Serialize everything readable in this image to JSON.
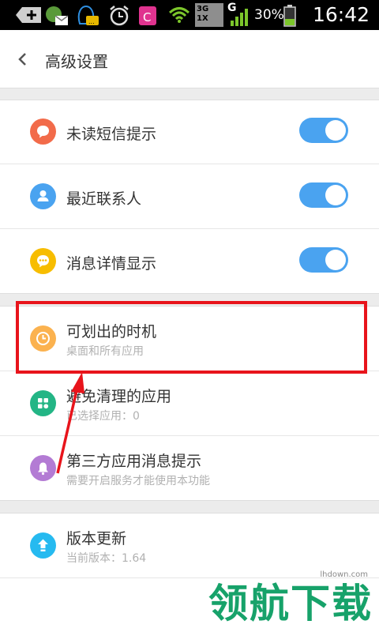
{
  "status_bar": {
    "network_label_top": "3G",
    "network_label_bottom": "1X",
    "signal_label": "G",
    "battery_percent": "30%",
    "time": "16:42"
  },
  "header": {
    "back_icon": "chevron-left-icon",
    "title": "高级设置"
  },
  "section1": {
    "items": [
      {
        "label": "未读短信提示",
        "icon": "message-bubble-icon",
        "icon_color": "#f26b4a",
        "toggle_on": true
      },
      {
        "label": "最近联系人",
        "icon": "person-icon",
        "icon_color": "#4aa3f0",
        "toggle_on": true
      },
      {
        "label": "消息详情显示",
        "icon": "chat-dots-icon",
        "icon_color": "#f7bd00",
        "toggle_on": true
      }
    ]
  },
  "section2": {
    "items": [
      {
        "label": "可划出的时机",
        "sub": "桌面和所有应用",
        "icon": "clock-icon",
        "icon_color": "#fbb24f"
      },
      {
        "label": "避免清理的应用",
        "sub": "已选择应用：0",
        "icon": "apps-grid-icon",
        "icon_color": "#23b585"
      },
      {
        "label": "第三方应用消息提示",
        "sub": "需要开启服务才能使用本功能",
        "icon": "bell-icon",
        "icon_color": "#b37bd4"
      }
    ]
  },
  "section3": {
    "items": [
      {
        "label": "版本更新",
        "sub": "当前版本：1.64",
        "icon": "upload-arrow-icon",
        "icon_color": "#26baf0"
      }
    ]
  },
  "watermark": {
    "text": "领航下载",
    "url": "lhdown.com"
  },
  "colors": {
    "toggle_on": "#4aa3f0",
    "highlight": "#e8141b",
    "watermark": "#17a26a"
  }
}
